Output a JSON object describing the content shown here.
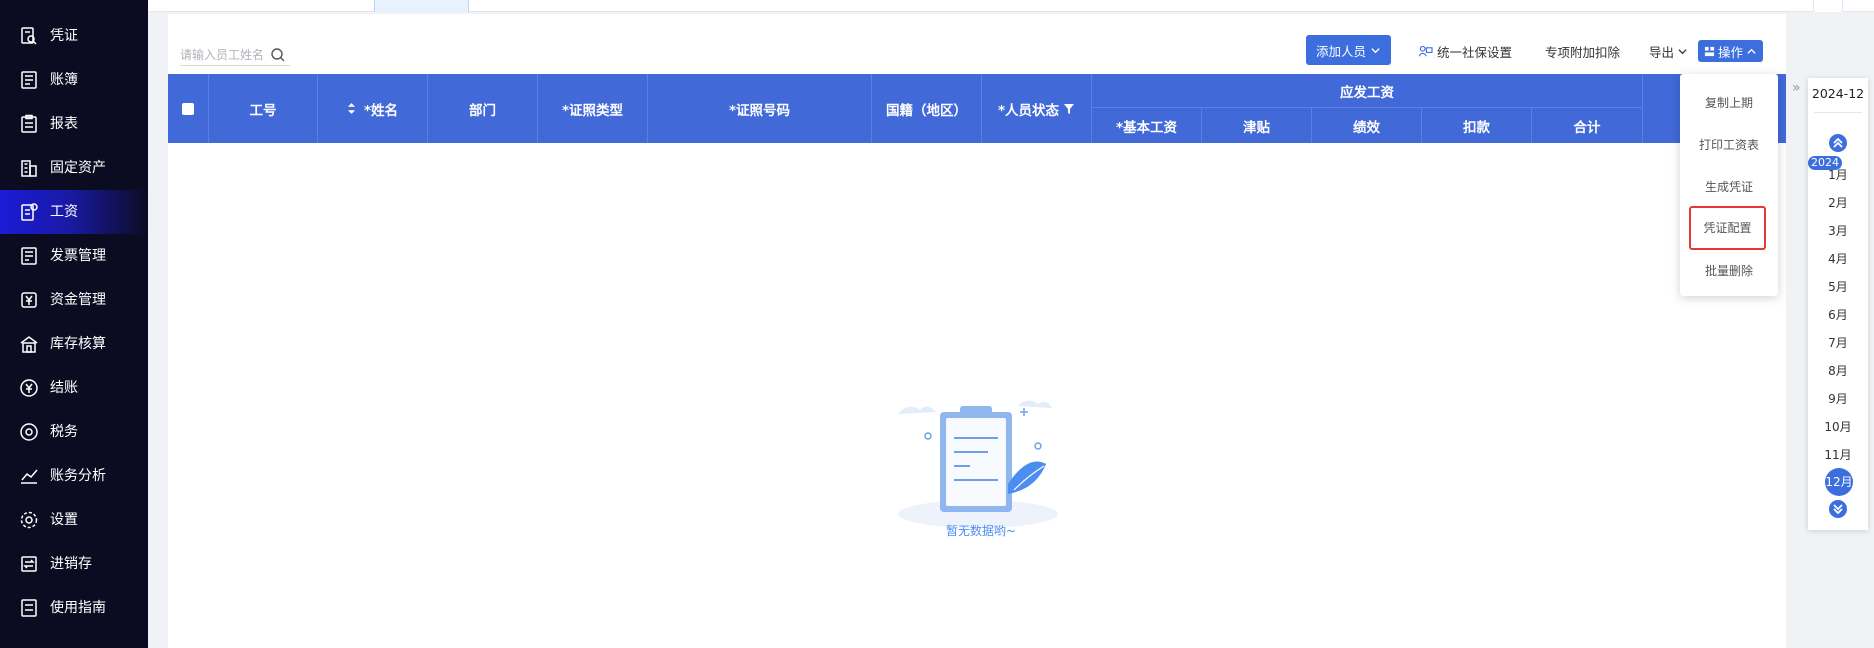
{
  "sidebar": {
    "items": [
      {
        "label": "凭证",
        "icon": "voucher-search-icon"
      },
      {
        "label": "账簿",
        "icon": "ledger-icon"
      },
      {
        "label": "报表",
        "icon": "report-icon"
      },
      {
        "label": "固定资产",
        "icon": "building-icon"
      },
      {
        "label": "工资",
        "icon": "salary-icon"
      },
      {
        "label": "发票管理",
        "icon": "invoice-icon"
      },
      {
        "label": "资金管理",
        "icon": "yen-box-icon"
      },
      {
        "label": "库存核算",
        "icon": "warehouse-icon"
      },
      {
        "label": "结账",
        "icon": "yen-circle-icon"
      },
      {
        "label": "税务",
        "icon": "tax-icon"
      },
      {
        "label": "账务分析",
        "icon": "chart-line-icon"
      },
      {
        "label": "设置",
        "icon": "gear-icon"
      },
      {
        "label": "进销存",
        "icon": "transfer-icon"
      },
      {
        "label": "使用指南",
        "icon": "guide-icon"
      }
    ],
    "active": "工资"
  },
  "toolbar": {
    "search_placeholder": "请输入员工姓名",
    "add_person": "添加人员",
    "social_security": "统一社保设置",
    "special_deduction": "专项附加扣除",
    "export": "导出",
    "operation": "操作"
  },
  "table": {
    "headers": {
      "emp_no": "工号",
      "name": "*姓名",
      "dept": "部门",
      "id_type": "*证照类型",
      "id_number": "*证照号码",
      "nationality": "国籍（地区）",
      "status": "*人员状态",
      "salary_group": "应发工资",
      "base_salary": "*基本工资",
      "allowance": "津贴",
      "performance": "绩效",
      "deduction": "扣款",
      "total": "合计"
    },
    "empty_text": "暂无数据哟~"
  },
  "dropdown": {
    "items": [
      "复制上期",
      "打印工资表",
      "生成凭证",
      "凭证配置",
      "批量删除"
    ],
    "highlighted": "凭证配置"
  },
  "period_panel": {
    "current_period": "2024-12",
    "year": "2024",
    "months": [
      "1月",
      "2月",
      "3月",
      "4月",
      "5月",
      "6月",
      "7月",
      "8月",
      "9月",
      "10月",
      "11月",
      "12月"
    ],
    "selected_month": "12月"
  },
  "colors": {
    "sidebar_bg": "#0b0c22",
    "accent": "#3c6ede",
    "header_bg": "#4169d8",
    "highlight_border": "#e53935"
  }
}
